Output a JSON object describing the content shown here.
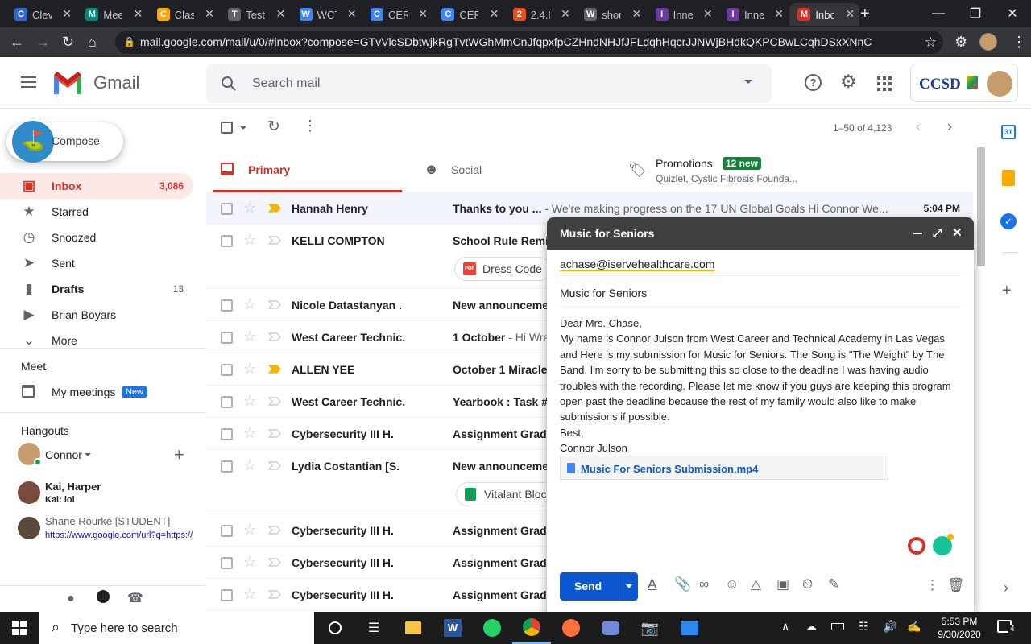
{
  "browser": {
    "tabs": [
      {
        "title": "Clev",
        "icon": "C",
        "color": "#3367d6"
      },
      {
        "title": "Mee",
        "icon": "M",
        "color": "#00897b"
      },
      {
        "title": "Clas",
        "icon": "C",
        "color": "#f9ab00"
      },
      {
        "title": "Test",
        "icon": "T",
        "color": "#5f6368"
      },
      {
        "title": "WCT",
        "icon": "W",
        "color": "#4285f4"
      },
      {
        "title": "CER",
        "icon": "C",
        "color": "#4285f4"
      },
      {
        "title": "CER",
        "icon": "C",
        "color": "#4285f4"
      },
      {
        "title": "2.4.6",
        "icon": "2",
        "color": "#e94e1b"
      },
      {
        "title": "shor",
        "icon": "W",
        "color": "#5f6368"
      },
      {
        "title": "Inne",
        "icon": "I",
        "color": "#6a3aa0"
      },
      {
        "title": "Inne",
        "icon": "I",
        "color": "#6a3aa0"
      },
      {
        "title": "Inbo",
        "icon": "M",
        "color": "#d93025"
      }
    ],
    "url": "mail.google.com/mail/u/0/#inbox?compose=GTvVlcSDbtwjkRgTvtWGhMmCnJfqpxfpCZHndNHJfJFLdqhHqcrJJNWjBHdkQKPCBwLCqhDSxXNnC"
  },
  "gmail": {
    "logo_text": "Gmail",
    "search_placeholder": "Search mail",
    "org_badge": "CCSD",
    "compose_label": "Compose",
    "nav": [
      {
        "label": "Inbox",
        "count": "3,086",
        "icon": "inbox-icon",
        "active": true
      },
      {
        "label": "Starred",
        "count": "",
        "icon": "star-icon"
      },
      {
        "label": "Snoozed",
        "count": "",
        "icon": "clock-icon"
      },
      {
        "label": "Sent",
        "count": "",
        "icon": "send-icon"
      },
      {
        "label": "Drafts",
        "count": "13",
        "icon": "draft-icon"
      },
      {
        "label": "Brian Boyars",
        "count": "",
        "icon": "label-icon"
      },
      {
        "label": "More",
        "count": "",
        "icon": "chevron-down-icon"
      }
    ],
    "meet": {
      "title": "Meet",
      "my_meetings": "My meetings",
      "new_badge": "New"
    },
    "hangouts": {
      "title": "Hangouts",
      "user": "Connor",
      "chats": [
        {
          "name": "Kai, Harper",
          "preview": "Kai: lol"
        },
        {
          "name": "Shane Rourke [STUDENT]",
          "preview": "https://www.google.com/url?q=https://"
        }
      ]
    },
    "toolbar": {
      "pagination": "1–50 of 4,123"
    },
    "categories": [
      {
        "label": "Primary",
        "sub": ""
      },
      {
        "label": "Social",
        "sub": ""
      },
      {
        "label": "Promotions",
        "sub": "Quizlet, Cystic Fibrosis Founda...",
        "badge": "12 new"
      }
    ],
    "emails": [
      {
        "sender": "Hannah Henry",
        "subject": "Thanks to you ...",
        "preview": " - We're making progress on the 17 UN Global Goals Hi Connor We...",
        "time": "5:04 PM",
        "important": true
      },
      {
        "sender": "KELLI COMPTON",
        "subject": "School Rule Remir",
        "preview": "",
        "time": "",
        "important": false,
        "chip": "Dress Code"
      },
      {
        "sender": "Nicole Datastanyan .",
        "subject": "New announcemer",
        "preview": "",
        "time": "",
        "important": false
      },
      {
        "sender": "West Career Technic.",
        "subject": "1 October",
        "preview": " - Hi Wra",
        "time": "",
        "important": false
      },
      {
        "sender": "ALLEN YEE",
        "subject": "October 1 Miracle",
        "preview": "",
        "time": "",
        "important": true
      },
      {
        "sender": "West Career Technic.",
        "subject": "Yearbook : Task #",
        "preview": "",
        "time": "",
        "important": false
      },
      {
        "sender": "Cybersecurity III H.",
        "subject": "Assignment Grade",
        "preview": "",
        "time": "",
        "important": false
      },
      {
        "sender": "Lydia Costantian [S.",
        "subject": "New announcemer",
        "preview": "",
        "time": "",
        "important": false,
        "chip": "Vitalant Bloc"
      },
      {
        "sender": "Cybersecurity III H.",
        "subject": "Assignment Grade",
        "preview": "",
        "time": "",
        "important": false
      },
      {
        "sender": "Cybersecurity III H.",
        "subject": "Assignment Grade",
        "preview": "",
        "time": "",
        "important": false
      },
      {
        "sender": "Cybersecurity III H.",
        "subject": "Assignment Grade",
        "preview": "",
        "time": "",
        "important": false
      }
    ]
  },
  "compose": {
    "title": "Music for Seniors",
    "to": "achase@iservehealthcare.com",
    "subject": "Music for Seniors",
    "body": [
      "Dear Mrs. Chase,",
      "My name is Connor Julson from West Career and Technical Academy in Las Vegas and Here is my submission for Music for Seniors. The Song is \"The Weight\" by The Band. I'm sorry to be submitting this so close to the deadline I was having audio troubles with the recording. Please let me know if you guys are keeping this program open past the deadline because the rest of my family would also like to make submissions if possible.",
      "Best,",
      "Connor Julson"
    ],
    "attachment": "Music For Seniors Submission.mp4",
    "send_label": "Send"
  },
  "taskbar": {
    "search_placeholder": "Type here to search",
    "time": "5:53 PM",
    "date": "9/30/2020",
    "notifications": "4"
  },
  "colors": {
    "gmail_red": "#d93025",
    "send_blue": "#0b57d0",
    "chrome_dark": "#202124",
    "promo_green": "#188038"
  }
}
